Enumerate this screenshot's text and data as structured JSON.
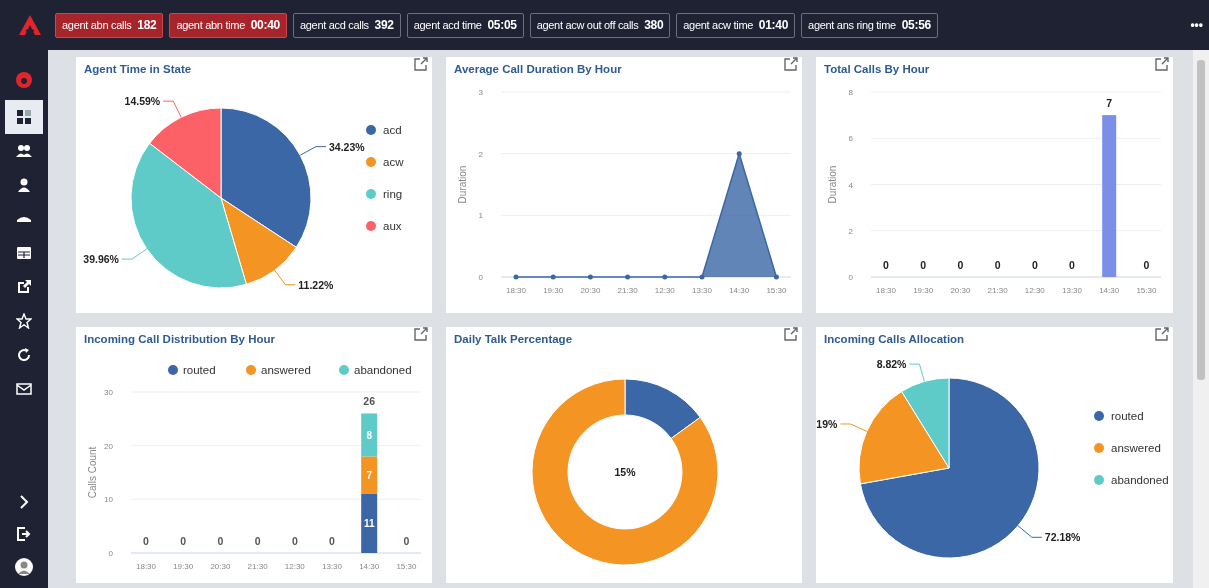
{
  "top_bar": {
    "metrics": [
      {
        "label": "agent abn calls",
        "value": "182",
        "alert": true
      },
      {
        "label": "agent abn time",
        "value": "00:40",
        "alert": true
      },
      {
        "label": "agent acd calls",
        "value": "392",
        "alert": false
      },
      {
        "label": "agent acd time",
        "value": "05:05",
        "alert": false
      },
      {
        "label": "agent acw out off calls",
        "value": "380",
        "alert": false
      },
      {
        "label": "agent acw time",
        "value": "01:40",
        "alert": false
      },
      {
        "label": "agent ans ring time",
        "value": "05:56",
        "alert": false
      }
    ],
    "more": "•••"
  },
  "sidebar": {
    "items": [
      {
        "selected": true
      },
      {
        "selected": false
      },
      {
        "selected": false
      },
      {
        "selected": false
      },
      {
        "selected": false
      },
      {
        "selected": false
      },
      {
        "selected": false
      },
      {
        "selected": false
      },
      {
        "selected": false
      }
    ]
  },
  "panels": [
    {
      "title": "Agent Time in State",
      "chart_data": {
        "type": "pie",
        "categories": [
          "acd",
          "acw",
          "ring",
          "aux"
        ],
        "values": [
          34.23,
          11.22,
          39.96,
          14.59
        ],
        "colors": [
          "#3b67a6",
          "#f39423",
          "#5ecbc8",
          "#fb6166"
        ],
        "legend": true,
        "value_labels": [
          "34.23%",
          "11.22%",
          "39.96%",
          "14.59%"
        ]
      }
    },
    {
      "title": "Average Call Duration By Hour",
      "chart_data": {
        "type": "area",
        "ylabel": "Duration",
        "categories": [
          "18:30",
          "19:30",
          "20:30",
          "21:30",
          "12:30",
          "13:30",
          "14:30",
          "15:30"
        ],
        "series": [
          {
            "color": "#3b67a6",
            "values": [
              0,
              0,
              0,
              0,
              0,
              0,
              2,
              0
            ]
          }
        ],
        "grid": true,
        "ylim": [
          0,
          3
        ],
        "yticks": [
          0,
          1,
          2,
          3
        ]
      }
    },
    {
      "title": "Total Calls By Hour",
      "chart_data": {
        "type": "bar",
        "ylabel": "Duration",
        "categories": [
          "18:30",
          "19:30",
          "20:30",
          "21:30",
          "12:30",
          "13:30",
          "14:30",
          "15:30"
        ],
        "series": [
          {
            "color": "#7b8fe8",
            "values": [
              0,
              0,
              0,
              0,
              0,
              0,
              7,
              0
            ]
          }
        ],
        "grid": true,
        "ylim": [
          0,
          8
        ],
        "yticks": [
          0,
          2,
          4,
          6,
          8
        ],
        "data_labels": true
      }
    },
    {
      "title": "Incoming Call Distribution By Hour",
      "chart_data": {
        "type": "bar",
        "stacked": true,
        "ylabel": "Calls Count",
        "categories": [
          "18:30",
          "19:30",
          "20:30",
          "21:30",
          "12:30",
          "13:30",
          "14:30",
          "15:30"
        ],
        "series": [
          {
            "name": "routed",
            "color": "#3b67a6",
            "values": [
              0,
              0,
              0,
              0,
              0,
              0,
              11,
              0
            ],
            "value_labels": [
              null,
              null,
              null,
              null,
              null,
              null,
              "11",
              null
            ]
          },
          {
            "name": "answered",
            "color": "#f39423",
            "values": [
              0,
              0,
              0,
              0,
              0,
              0,
              7,
              0
            ],
            "value_labels": [
              null,
              null,
              null,
              null,
              null,
              null,
              "7",
              null
            ]
          },
          {
            "name": "abandoned",
            "color": "#5ecbc8",
            "values": [
              0,
              0,
              0,
              0,
              0,
              0,
              8,
              0
            ],
            "value_labels": [
              null,
              null,
              null,
              null,
              null,
              null,
              "8",
              null
            ]
          }
        ],
        "annotations": [
          {
            "x": "18:30",
            "y": 0,
            "text": "0"
          },
          {
            "x": "19:30",
            "y": 0,
            "text": "0"
          },
          {
            "x": "20:30",
            "y": 0,
            "text": "0"
          },
          {
            "x": "21:30",
            "y": 0,
            "text": "0"
          },
          {
            "x": "12:30",
            "y": 0,
            "text": "0"
          },
          {
            "x": "13:30",
            "y": 0,
            "text": "0"
          },
          {
            "x": "14:30",
            "y": 26,
            "text": "26"
          },
          {
            "x": "15:30",
            "y": 0,
            "text": "0"
          }
        ],
        "legend": true,
        "grid": true,
        "ylim": [
          0,
          30
        ],
        "yticks": [
          0,
          10,
          20,
          30
        ]
      }
    },
    {
      "title": "Daily Talk Percentage",
      "chart_data": {
        "type": "donut",
        "values": [
          15,
          85
        ],
        "colors": [
          "#3b67a6",
          "#f39423"
        ],
        "annotations": [
          {
            "text": "15%"
          }
        ]
      }
    },
    {
      "title": "Incoming Calls Allocation",
      "chart_data": {
        "type": "pie",
        "categories": [
          "routed",
          "answered",
          "abandoned"
        ],
        "values": [
          72.18,
          19,
          8.82
        ],
        "colors": [
          "#3b67a6",
          "#f39423",
          "#5ecbc8"
        ],
        "legend": true,
        "value_labels": [
          "72.18%",
          "19%",
          "8.82%"
        ]
      }
    }
  ]
}
